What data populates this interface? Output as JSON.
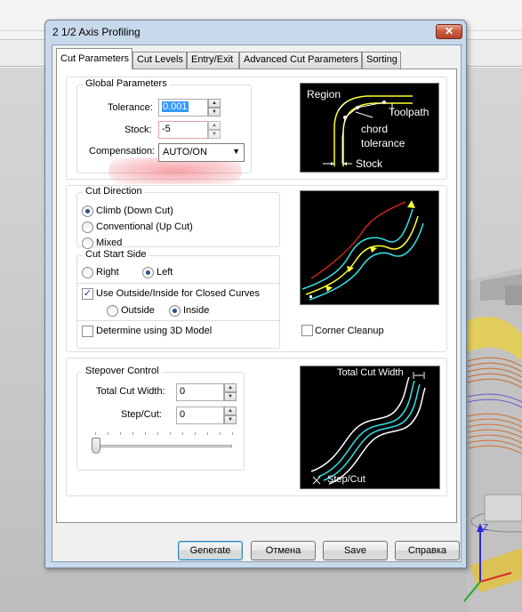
{
  "dialog": {
    "title": "2 1/2 Axis Profiling",
    "close_glyph": "✕"
  },
  "tabs": [
    {
      "label": "Cut Parameters"
    },
    {
      "label": "Cut Levels"
    },
    {
      "label": "Entry/Exit"
    },
    {
      "label": "Advanced Cut Parameters"
    },
    {
      "label": "Sorting"
    }
  ],
  "global_parameters": {
    "title": "Global Parameters",
    "tolerance_label": "Tolerance:",
    "tolerance_value": "0.001",
    "stock_label": "Stock:",
    "stock_value": "-5",
    "compensation_label": "Compensation:",
    "compensation_value": "AUTO/ON"
  },
  "diagram1": {
    "region": "Region",
    "toolpath": "Toolpath",
    "chord": "chord",
    "tolerance": "tolerance",
    "stock": "Stock"
  },
  "cut_direction": {
    "title": "Cut Direction",
    "options": [
      "Climb (Down Cut)",
      "Conventional (Up Cut)",
      "Mixed"
    ],
    "selected": "Climb (Down Cut)"
  },
  "cut_start_side": {
    "title": "Cut Start Side",
    "right_label": "Right",
    "left_label": "Left",
    "selected": "Left",
    "use_outside_inside_label": "Use Outside/Inside for Closed Curves",
    "use_outside_inside_checked": true,
    "outside_label": "Outside",
    "inside_label": "Inside",
    "outside_inside_selected": "Inside",
    "determine_3d_label": "Determine using 3D Model",
    "determine_3d_checked": false
  },
  "corner_cleanup": {
    "label": "Corner Cleanup",
    "checked": false
  },
  "stepover": {
    "title": "Stepover Control",
    "total_cut_width_label": "Total Cut Width:",
    "total_cut_width_value": "0",
    "step_cut_label": "Step/Cut:",
    "step_cut_value": "0",
    "slider_value": 0
  },
  "diagram3": {
    "total_cut_width": "Total Cut Width",
    "step_cut": "Step/Cut"
  },
  "buttons": {
    "generate": "Generate",
    "cancel": "Отмена",
    "save": "Save",
    "help": "Справка"
  },
  "check_glyph": "✓",
  "colors": {
    "diagram_bg": "#000000",
    "yellow_path": "#ffff33",
    "cyan_path": "#33e0e6",
    "red_line": "#cc2020",
    "stock_highlight": "#f07a84",
    "default_button_border": "#3c7fb1"
  }
}
